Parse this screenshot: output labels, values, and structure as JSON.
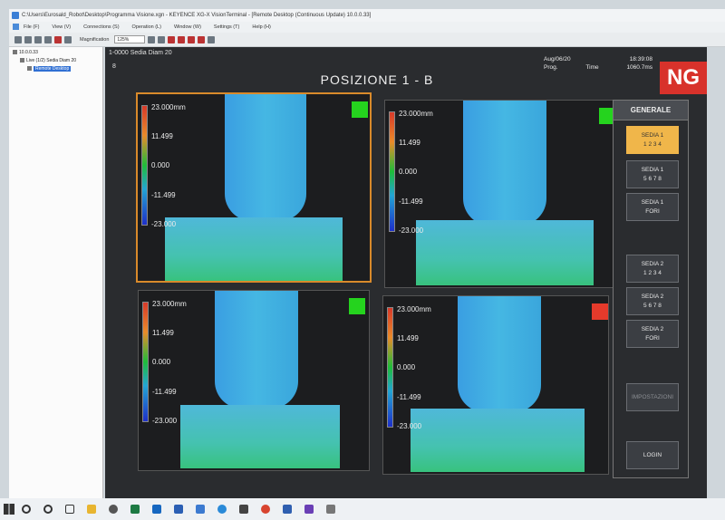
{
  "window": {
    "title": "C:\\Users\\Eurosald_Robot\\Desktop\\Programma Visione.xgn - KEYENCE XG-X VisionTerminal - [Remote Desktop (Continuous Update) 10.0.0.33]"
  },
  "menu": [
    "File (F)",
    "View (V)",
    "Connections (S)",
    "Operation (L)",
    "Window (W)",
    "Settings (T)",
    "Help (H)"
  ],
  "toolbar": {
    "magnification_label": "Magnification",
    "magnification_value": "125%"
  },
  "tree": {
    "root": "10.0.0.33",
    "child": "Live (1/2) Sedia Diam 20",
    "selected": "Remote Desktop"
  },
  "remote": {
    "header_left": "1-0000 Sedia Diam 20",
    "header_left2": "8",
    "date": "Aug/06/20",
    "time": "18:39:08",
    "prog_label": "Prog.",
    "time_label": "Time",
    "prog_time": "1060.7ms",
    "result": "NG",
    "position_title": "POSIZIONE 1 - B",
    "accent_result": "#d8322b",
    "accent_selected": "#f0b64a"
  },
  "panels": [
    {
      "ticks": [
        "23.000mm",
        "11.499",
        "0.000",
        "-11.499",
        "-23.000"
      ],
      "status": "ok"
    },
    {
      "ticks": [
        "23.000mm",
        "11.499",
        "0.000",
        "-11.499",
        "-23.000"
      ],
      "status": "ok"
    },
    {
      "ticks": [
        "23.000mm",
        "11.499",
        "0.000",
        "-11.499",
        "-23.000"
      ],
      "status": "ok"
    },
    {
      "ticks": [
        "23.000mm",
        "11.499",
        "0.000",
        "-11.499",
        "-23.000"
      ],
      "status": "ng"
    }
  ],
  "side": {
    "header": "GENERALE",
    "buttons": [
      {
        "line1": "SEDIA 1",
        "line2": "1 2 3 4"
      },
      {
        "line1": "SEDIA 1",
        "line2": "5 6 7 8"
      },
      {
        "line1": "SEDIA 1",
        "line2": "FORI"
      },
      {
        "line1": "SEDIA 2",
        "line2": "1 2 3 4"
      },
      {
        "line1": "SEDIA 2",
        "line2": "5 6 7 8"
      },
      {
        "line1": "SEDIA 2",
        "line2": "FORI"
      },
      {
        "line1": "IMPOSTAZIONI",
        "line2": ""
      },
      {
        "line1": "LOGIN",
        "line2": ""
      }
    ]
  }
}
